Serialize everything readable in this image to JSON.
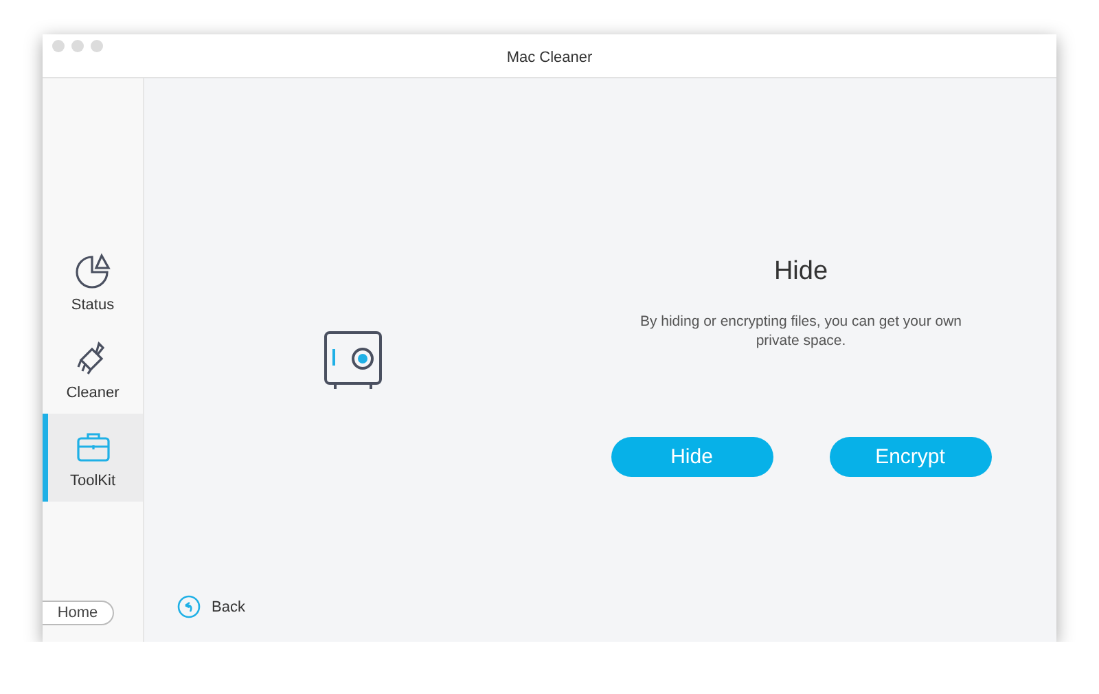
{
  "window": {
    "title": "Mac Cleaner"
  },
  "sidebar": {
    "items": [
      {
        "label": "Status",
        "selected": false
      },
      {
        "label": "Cleaner",
        "selected": false
      },
      {
        "label": "ToolKit",
        "selected": true
      }
    ],
    "home_button": "Home"
  },
  "main": {
    "title": "Hide",
    "description": "By hiding or encrypting files, you can get your own private space.",
    "buttons": [
      "Hide",
      "Encrypt"
    ],
    "back": "Back"
  }
}
